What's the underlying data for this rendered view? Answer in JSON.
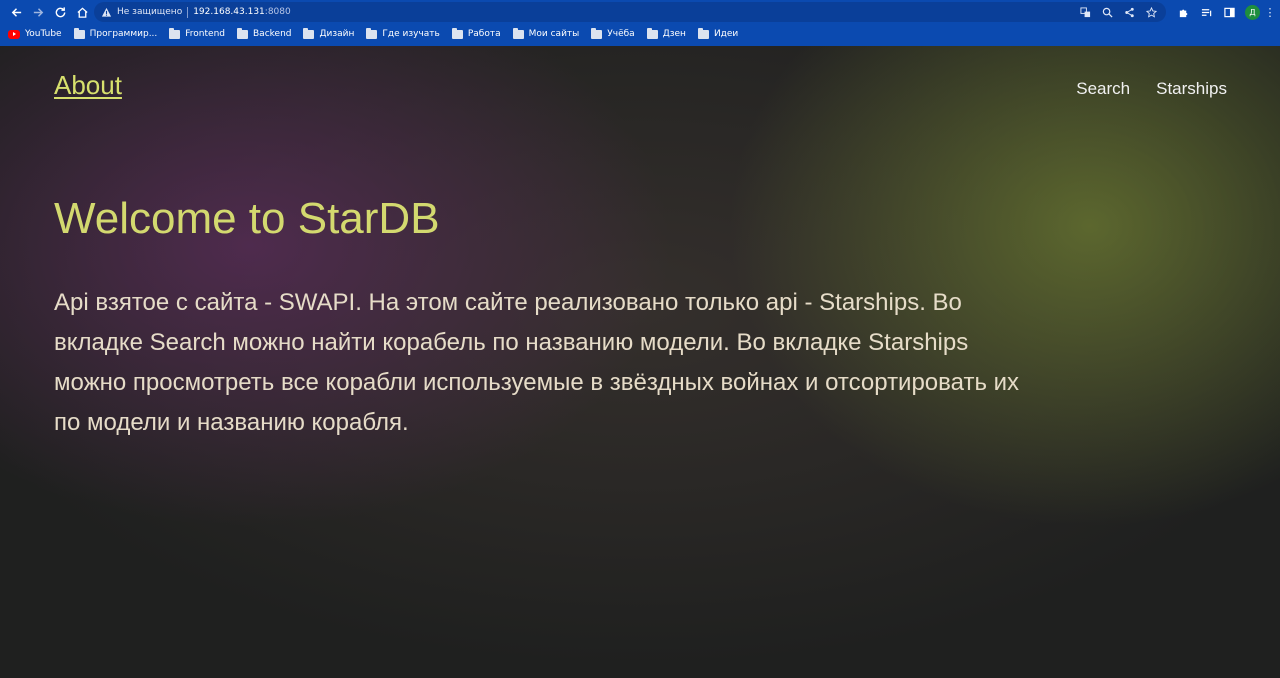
{
  "browser": {
    "insecure_label": "Не защищено",
    "url_host": "192.168.43.131",
    "url_port": ":8080",
    "profile_initial": "Д",
    "bookmarks": [
      {
        "label": "YouTube",
        "icon": "youtube-icon"
      },
      {
        "label": "Программир...",
        "icon": "folder-icon"
      },
      {
        "label": "Frontend",
        "icon": "folder-icon"
      },
      {
        "label": "Backend",
        "icon": "folder-icon"
      },
      {
        "label": "Дизайн",
        "icon": "folder-icon"
      },
      {
        "label": "Где изучать",
        "icon": "folder-icon"
      },
      {
        "label": "Работа",
        "icon": "folder-icon"
      },
      {
        "label": "Мои сайты",
        "icon": "folder-icon"
      },
      {
        "label": "Учёба",
        "icon": "folder-icon"
      },
      {
        "label": "Дзен",
        "icon": "folder-icon"
      },
      {
        "label": "Идеи",
        "icon": "folder-icon"
      }
    ],
    "colors": {
      "chrome": "#0b4ab0",
      "omnibox": "#0a3f99"
    }
  },
  "site": {
    "logo": "About",
    "nav": [
      {
        "label": "Search"
      },
      {
        "label": "Starships"
      }
    ],
    "hero_title": "Welcome to StarDB",
    "hero_text": "Api взятое с сайта - SWAPI. На этом сайте реализовано только api - Starships. Во вкладке Search можно найти корабель по названию модели. Во вкладке Starships можно просмотреть все корабли используемые в звёздных войнах и отсортировать их по модели и названию корабля.",
    "colors": {
      "accent": "#d3d96f",
      "text": "#e6dcc8",
      "background": "#1f201f"
    }
  }
}
